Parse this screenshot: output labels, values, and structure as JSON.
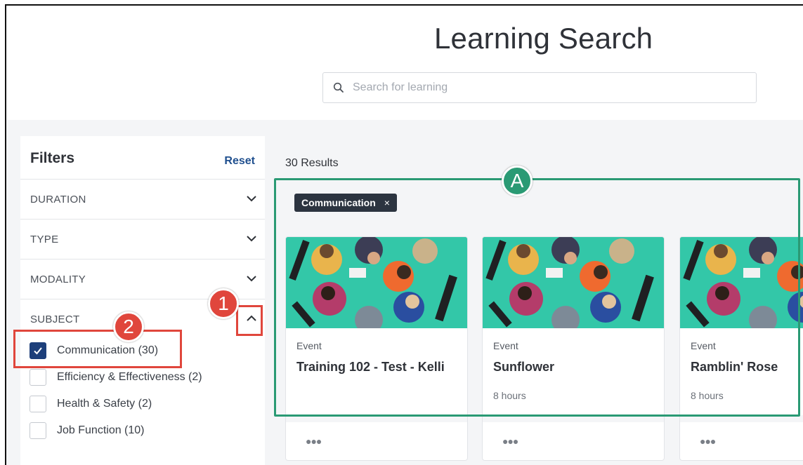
{
  "header": {
    "title": "Learning Search",
    "search_placeholder": "Search for learning"
  },
  "filters": {
    "heading": "Filters",
    "reset_label": "Reset",
    "sections": [
      {
        "label": "DURATION"
      },
      {
        "label": "TYPE"
      },
      {
        "label": "MODALITY"
      },
      {
        "label": "SUBJECT"
      }
    ],
    "subject_options": [
      {
        "label": "Communication (30)",
        "checked": true
      },
      {
        "label": "Efficiency & Effectiveness (2)",
        "checked": false
      },
      {
        "label": "Health & Safety (2)",
        "checked": false
      },
      {
        "label": "Job Function (10)",
        "checked": false
      }
    ]
  },
  "results": {
    "count_label": "30 Results",
    "active_chip": "Communication",
    "chip_remove": "×",
    "cards": [
      {
        "type": "Event",
        "title": "Training 102 - Test - Kelli",
        "duration": "",
        "more": "●●●"
      },
      {
        "type": "Event",
        "title": "Sunflower",
        "duration": "8 hours",
        "more": "●●●"
      },
      {
        "type": "Event",
        "title": "Ramblin' Rose",
        "duration": "8 hours",
        "more": "●●●"
      }
    ]
  },
  "annotations": {
    "a_label": "A",
    "one_label": "1",
    "two_label": "2",
    "green": "#2a9a74",
    "red": "#e0463c"
  }
}
